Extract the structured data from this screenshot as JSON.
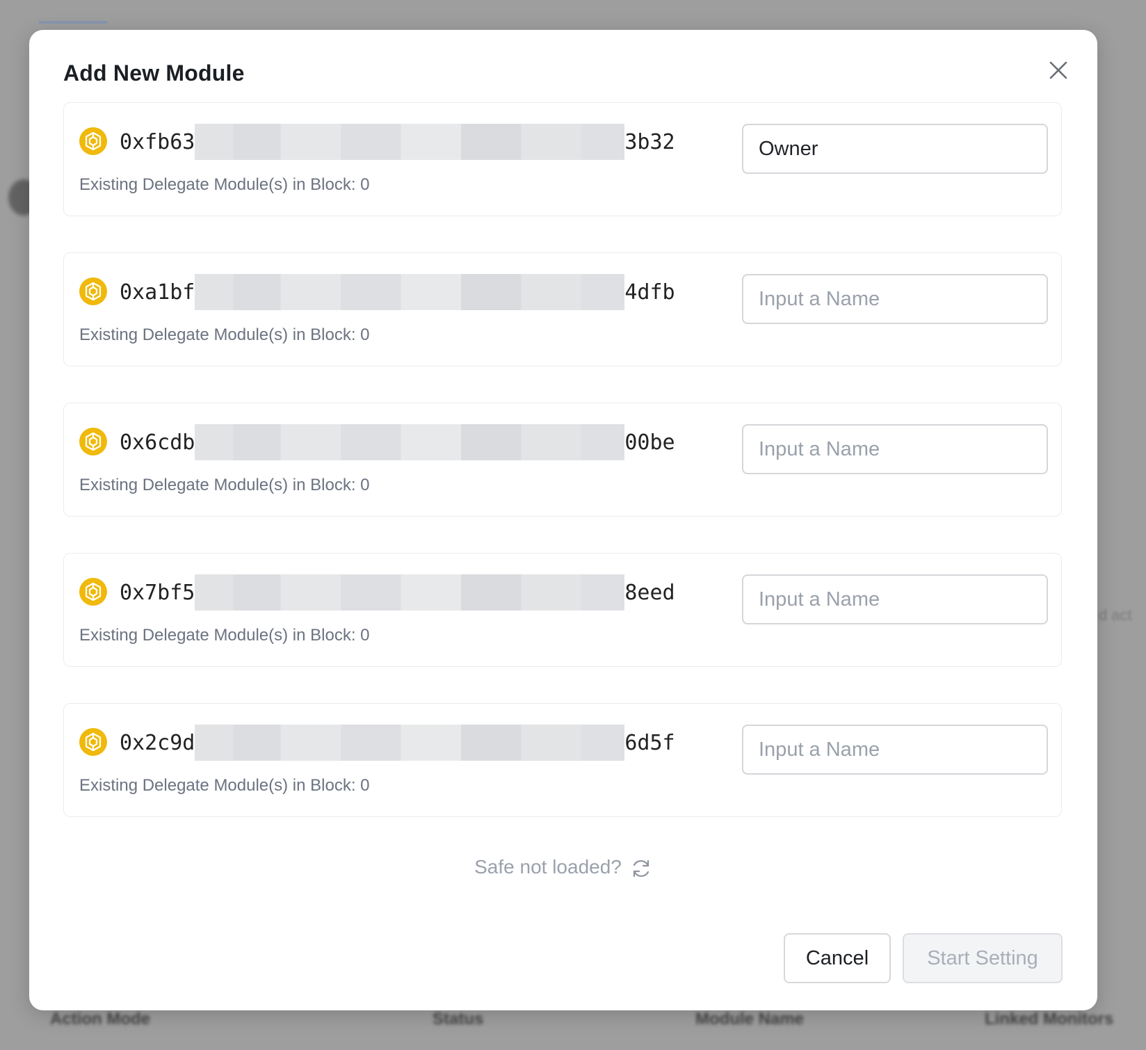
{
  "background": {
    "right_partial_text": "d act",
    "columns": [
      "Action Mode",
      "Status",
      "Module Name",
      "Linked Monitors"
    ]
  },
  "modal": {
    "title": "Add New Module",
    "close_icon": "close-icon",
    "chain_icon": "bnb-coin-icon",
    "modules": [
      {
        "addr_prefix": "0xfb63",
        "addr_suffix": "3b32",
        "existing": "Existing Delegate Module(s) in Block: 0",
        "name_value": "Owner",
        "placeholder": "Input a Name"
      },
      {
        "addr_prefix": "0xa1bf",
        "addr_suffix": "4dfb",
        "existing": "Existing Delegate Module(s) in Block: 0",
        "name_value": "",
        "placeholder": "Input a Name"
      },
      {
        "addr_prefix": "0x6cdb",
        "addr_suffix": "00be",
        "existing": "Existing Delegate Module(s) in Block: 0",
        "name_value": "",
        "placeholder": "Input a Name"
      },
      {
        "addr_prefix": "0x7bf5",
        "addr_suffix": "8eed",
        "existing": "Existing Delegate Module(s) in Block: 0",
        "name_value": "",
        "placeholder": "Input a Name"
      },
      {
        "addr_prefix": "0x2c9d",
        "addr_suffix": "6d5f",
        "existing": "Existing Delegate Module(s) in Block: 0",
        "name_value": "",
        "placeholder": "Input a Name"
      }
    ],
    "safe_not_loaded": "Safe not loaded?",
    "refresh_icon": "refresh-icon",
    "cancel_label": "Cancel",
    "start_label": "Start Setting"
  },
  "colors": {
    "coin": "#F0B90B",
    "disabled_text": "#a9afb8",
    "muted_text": "#6b7280"
  }
}
